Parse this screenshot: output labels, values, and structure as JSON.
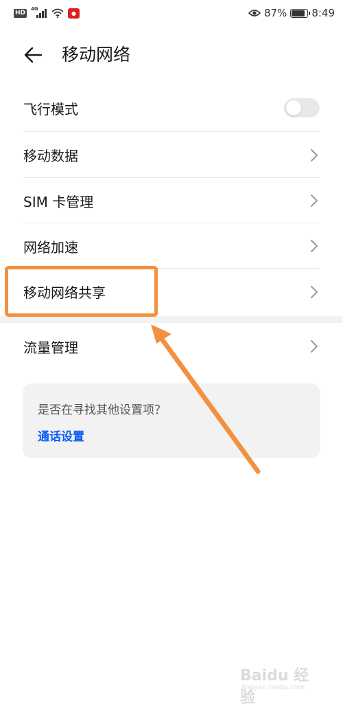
{
  "status_bar": {
    "hd": "HD",
    "network": "4G",
    "battery_percent": "87%",
    "battery_level": 0.87,
    "time": "8:49"
  },
  "header": {
    "title": "移动网络",
    "back_icon": "arrow-left-icon"
  },
  "menu": {
    "items": [
      {
        "label": "飞行模式",
        "control": "toggle",
        "checked": false
      },
      {
        "label": "移动数据",
        "control": "chevron"
      },
      {
        "label": "SIM 卡管理",
        "control": "chevron"
      },
      {
        "label": "网络加速",
        "control": "chevron"
      },
      {
        "label": "移动网络共享",
        "control": "chevron"
      },
      {
        "label": "流量管理",
        "control": "chevron"
      }
    ]
  },
  "suggestion": {
    "question": "是否在寻找其他设置项？",
    "link": "通话设置"
  },
  "annotation": {
    "highlight_color": "#f39140"
  },
  "watermark": {
    "text": "Baidu 经验",
    "sub": "jingyan.baidu.com"
  },
  "colors": {
    "link": "#0a59f7",
    "toggle_off": "#e8e8e8",
    "card_bg": "#f2f2f2"
  }
}
